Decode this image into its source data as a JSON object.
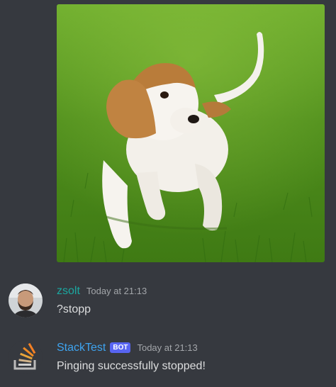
{
  "messages": [
    {
      "username": "zsolt",
      "timestamp": "Today at 21:13",
      "content": "?stopp"
    },
    {
      "username": "StackTest",
      "badge": "BOT",
      "timestamp": "Today at 21:13",
      "content": "Pinging successfully stopped!"
    }
  ],
  "colors": {
    "background": "#36393f",
    "username_zsolt": "#1ba7a0",
    "username_bot": "#3ea4f0",
    "bot_badge": "#5865f2",
    "timestamp": "#a3a6aa",
    "message_text": "#dcddde"
  },
  "attachment": {
    "type": "image",
    "subject": "beagle-puppy-on-grass"
  }
}
